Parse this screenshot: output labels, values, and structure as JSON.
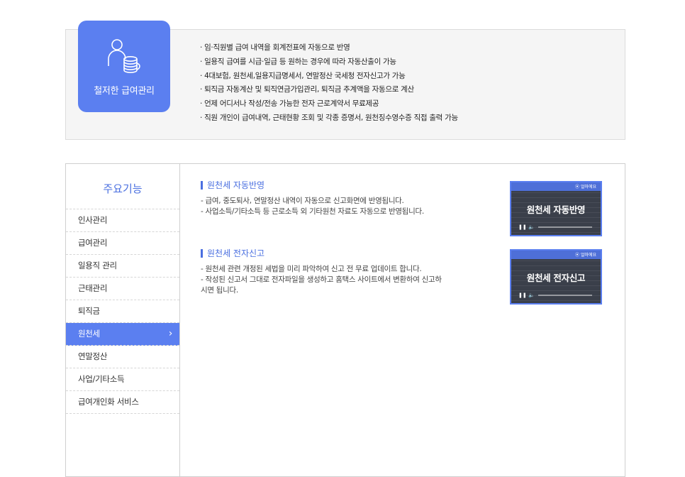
{
  "feature": {
    "badge_label": "철저한 급여관리",
    "bullets": [
      "· 임·직원별 급여 내역을 회계전표에 자동으로 반영",
      "· 일용직 급여를 시급·일급 등 원하는 경우에 따라 자동산출이 가능",
      "· 4대보험, 원천세,일용지급명세서, 연말정산 국세청 전자신고가 가능",
      "· 퇴직금 자동계산 및 퇴직연금가입관리, 퇴직금 추계액을 자동으로 계산",
      "· 언제 어디서나 작성/전송 가능한 전자 근로계약서 무료제공",
      "· 직원 개인이 급여내역, 근태현황 조회 및 각종 증명서, 원천징수영수증 직접 출력 가능"
    ],
    "colors": {
      "accent": "#5b7ff0",
      "box_bg": "#f5f5f5"
    }
  },
  "sidebar": {
    "title": "주요기능",
    "items": [
      {
        "label": "인사관리"
      },
      {
        "label": "급여관리"
      },
      {
        "label": "일용직 관리"
      },
      {
        "label": "근태관리"
      },
      {
        "label": "퇴직금"
      },
      {
        "label": "원천세",
        "active": true,
        "icon": "chevron-right-icon"
      },
      {
        "label": "연말정산"
      },
      {
        "label": "사업/기타소득"
      },
      {
        "label": "급여개인화 서비스"
      }
    ]
  },
  "sections": [
    {
      "title": "원천세 자동반영",
      "lines": [
        "- 급여, 중도퇴사, 연말정산 내역이 자동으로 신고화면에 반영됩니다.",
        "- 사업소득/기타소득 등 근로소득 외 기타원천 자료도 자동으로 반영됩니다."
      ],
      "video": {
        "title": "원천세 자동반영",
        "brand": "⦿ 얼마에요"
      }
    },
    {
      "title": "원천세 전자신고",
      "lines": [
        "- 원천세 관련 개정된 세법을 미리 파악하여 신고 전 무료 업데이트 합니다.",
        "- 작성된 신고서 그대로 전자파일을 생성하고 홈택스 사이트에서 변환하여 신고하",
        "시면 됩니다."
      ],
      "video": {
        "title": "원천세 전자신고",
        "brand": "⦿ 얼마에요"
      }
    }
  ]
}
